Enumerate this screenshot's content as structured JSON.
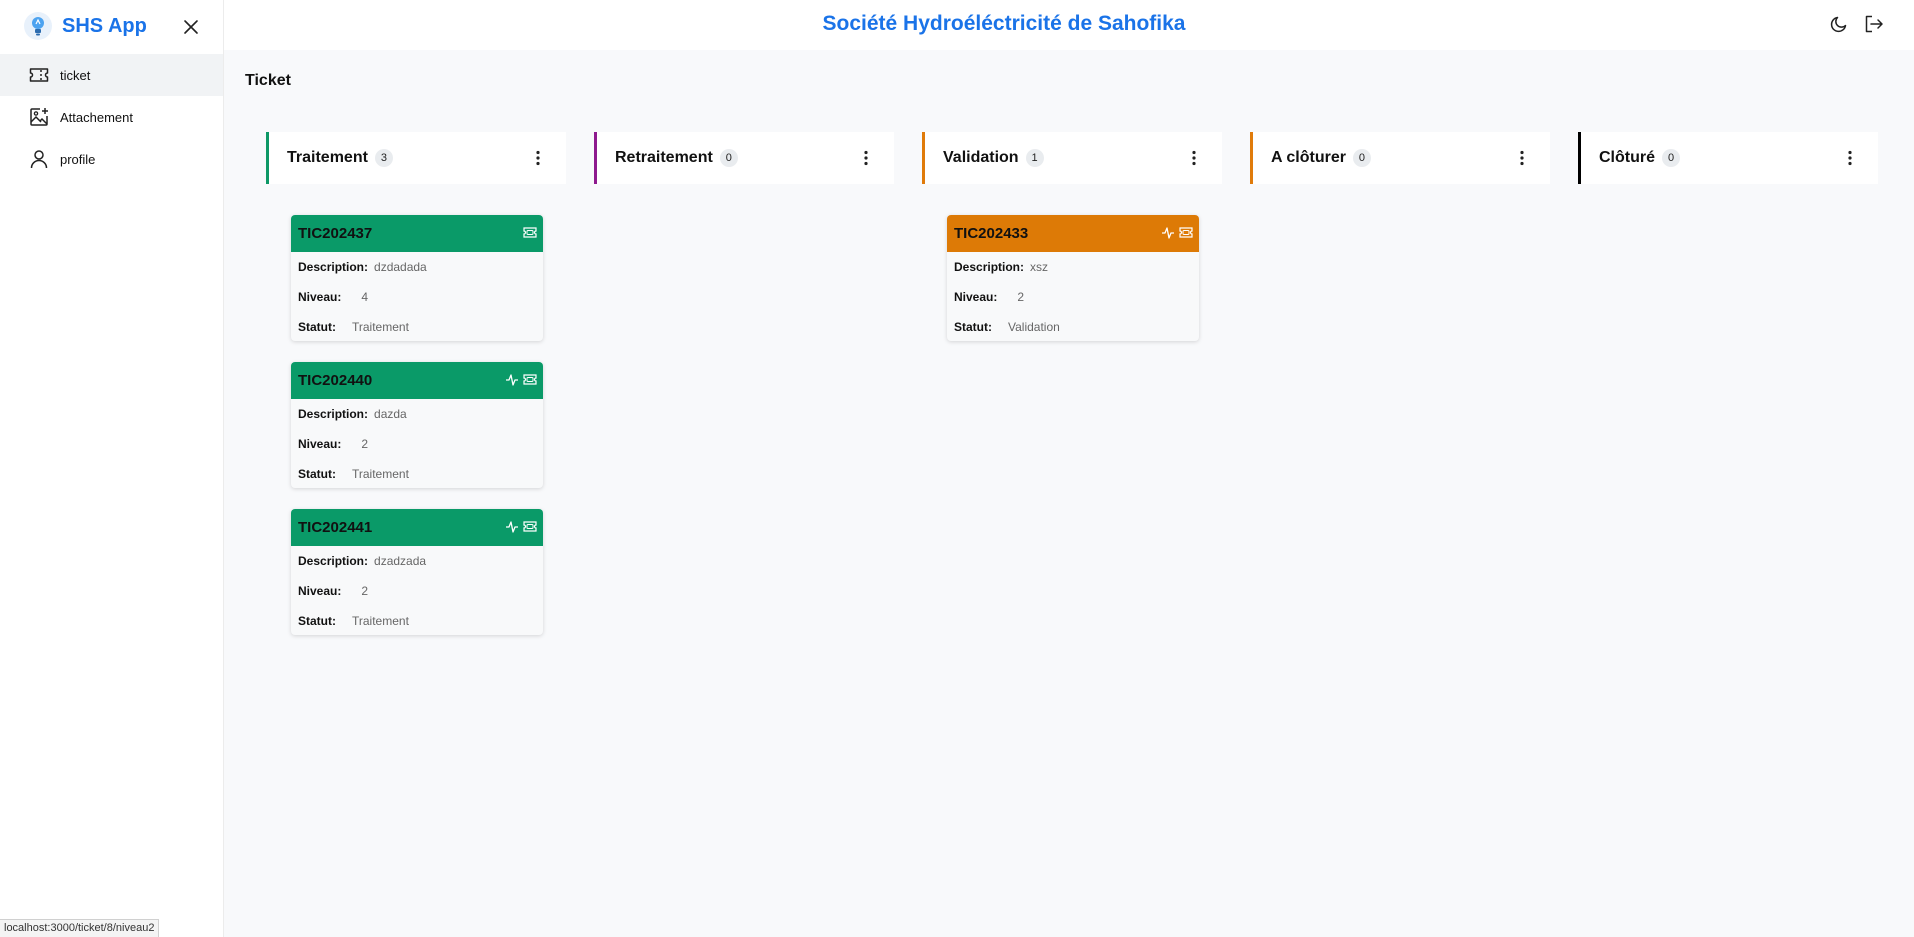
{
  "app": {
    "name": "SHS App",
    "title": "Société Hydroéléctricité de Sahofika"
  },
  "sidebar": {
    "items": [
      {
        "label": "ticket",
        "icon": "ticket-icon",
        "active": true
      },
      {
        "label": "Attachement",
        "icon": "image-plus-icon",
        "active": false
      },
      {
        "label": "profile",
        "icon": "user-icon",
        "active": false
      }
    ]
  },
  "status_bar": {
    "url": "localhost:3000/ticket/8/niveau2"
  },
  "page": {
    "title": "Ticket"
  },
  "columns": [
    {
      "title": "Traitement",
      "count": "3",
      "color": "#0d9866"
    },
    {
      "title": "Retraitement",
      "count": "0",
      "color": "#8e1a8e"
    },
    {
      "title": "Validation",
      "count": "1",
      "color": "#e07b0a"
    },
    {
      "title": "A clôturer",
      "count": "0",
      "color": "#e07b0a"
    },
    {
      "title": "Clôturé",
      "count": "0",
      "color": "#000000"
    }
  ],
  "labels": {
    "description": "Description:",
    "niveau": "Niveau:",
    "statut": "Statut:"
  },
  "tickets": [
    {
      "id": "TIC202437",
      "description": "dzdadada",
      "niveau": "4",
      "statut": "Traitement",
      "color": "#0a9a68",
      "icons": [
        "ticket-icon"
      ]
    },
    {
      "id": "TIC202440",
      "description": "dazda",
      "niveau": "2",
      "statut": "Traitement",
      "color": "#0a9a68",
      "icons": [
        "activity-icon",
        "ticket-icon"
      ]
    },
    {
      "id": "TIC202441",
      "description": "dzadzada",
      "niveau": "2",
      "statut": "Traitement",
      "color": "#0a9a68",
      "icons": [
        "activity-icon",
        "ticket-icon"
      ]
    },
    {
      "id": "TIC202433",
      "description": "xsz",
      "niveau": "2",
      "statut": "Validation",
      "color": "#dd7a06",
      "icons": [
        "activity-icon",
        "ticket-icon"
      ]
    }
  ]
}
